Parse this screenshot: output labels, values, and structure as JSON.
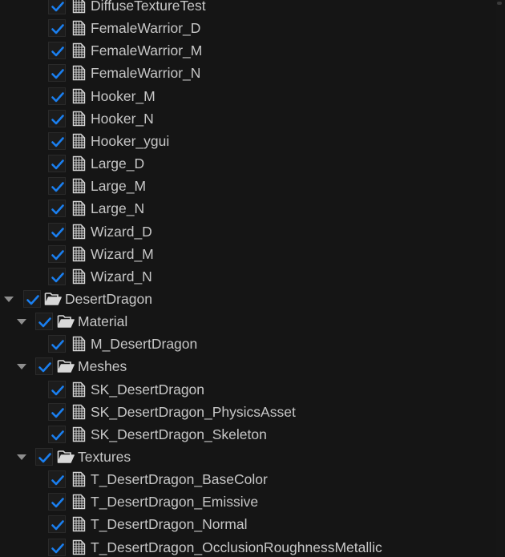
{
  "tree": {
    "rows": [
      {
        "label": "DiffuseTextureTest",
        "depth": 2,
        "kind": "asset",
        "checked": true,
        "partial": true
      },
      {
        "label": "FemaleWarrior_D",
        "depth": 2,
        "kind": "asset",
        "checked": true
      },
      {
        "label": "FemaleWarrior_M",
        "depth": 2,
        "kind": "asset",
        "checked": true
      },
      {
        "label": "FemaleWarrior_N",
        "depth": 2,
        "kind": "asset",
        "checked": true
      },
      {
        "label": "Hooker_M",
        "depth": 2,
        "kind": "asset",
        "checked": true
      },
      {
        "label": "Hooker_N",
        "depth": 2,
        "kind": "asset",
        "checked": true
      },
      {
        "label": "Hooker_ygui",
        "depth": 2,
        "kind": "asset",
        "checked": true
      },
      {
        "label": "Large_D",
        "depth": 2,
        "kind": "asset",
        "checked": true
      },
      {
        "label": "Large_M",
        "depth": 2,
        "kind": "asset",
        "checked": true
      },
      {
        "label": "Large_N",
        "depth": 2,
        "kind": "asset",
        "checked": true
      },
      {
        "label": "Wizard_D",
        "depth": 2,
        "kind": "asset",
        "checked": true
      },
      {
        "label": "Wizard_M",
        "depth": 2,
        "kind": "asset",
        "checked": true
      },
      {
        "label": "Wizard_N",
        "depth": 2,
        "kind": "asset",
        "checked": true
      },
      {
        "label": "DesertDragon",
        "depth": 0,
        "kind": "folder",
        "checked": true,
        "expanded": true
      },
      {
        "label": "Material",
        "depth": 1,
        "kind": "folder",
        "checked": true,
        "expanded": true
      },
      {
        "label": "M_DesertDragon",
        "depth": 2,
        "kind": "asset",
        "checked": true
      },
      {
        "label": "Meshes",
        "depth": 1,
        "kind": "folder",
        "checked": true,
        "expanded": true
      },
      {
        "label": "SK_DesertDragon",
        "depth": 2,
        "kind": "asset",
        "checked": true
      },
      {
        "label": "SK_DesertDragon_PhysicsAsset",
        "depth": 2,
        "kind": "asset",
        "checked": true
      },
      {
        "label": "SK_DesertDragon_Skeleton",
        "depth": 2,
        "kind": "asset",
        "checked": true
      },
      {
        "label": "Textures",
        "depth": 1,
        "kind": "folder",
        "checked": true,
        "expanded": true
      },
      {
        "label": "T_DesertDragon_BaseColor",
        "depth": 2,
        "kind": "asset",
        "checked": true
      },
      {
        "label": "T_DesertDragon_Emissive",
        "depth": 2,
        "kind": "asset",
        "checked": true
      },
      {
        "label": "T_DesertDragon_Normal",
        "depth": 2,
        "kind": "asset",
        "checked": true
      },
      {
        "label": "T_DesertDragon_OcclusionRoughnessMetallic",
        "depth": 2,
        "kind": "asset",
        "checked": true
      }
    ]
  },
  "colors": {
    "background": "#151515",
    "checkmark": "#1a7ff0",
    "text": "#c7c7c7",
    "icon": "#d8d8d8"
  },
  "icons": {
    "folder": "folder-open-icon",
    "asset": "asset-file-icon",
    "expander": "chevron-down-icon",
    "check": "checkmark-icon"
  }
}
